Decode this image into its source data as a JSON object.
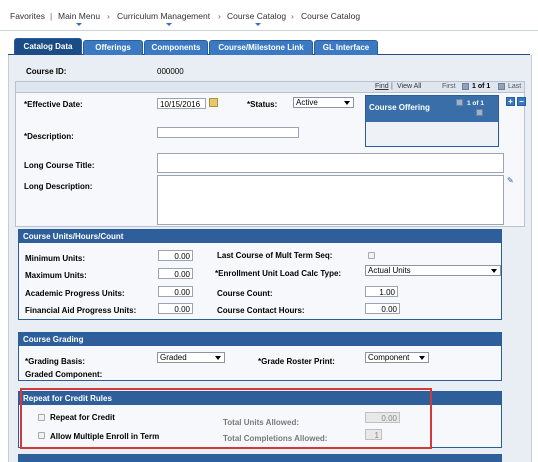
{
  "breadcrumb": {
    "items": [
      "Favorites",
      "Main Menu",
      "Curriculum Management",
      "Course Catalog",
      "Course Catalog"
    ],
    "separator": "›"
  },
  "tabs": [
    "Catalog Data",
    "Offerings",
    "Components",
    "Course/Milestone Link",
    "GL Interface"
  ],
  "header": {
    "course_id_label": "Course ID:",
    "course_id_value": "000000"
  },
  "nav": {
    "find": "Find",
    "view_all": "View All",
    "first": "First",
    "page_info": "1 of 1",
    "last": "Last"
  },
  "form": {
    "effective_date_label": "*Effective Date:",
    "effective_date_value": "10/15/2016",
    "status_label": "*Status:",
    "status_value": "Active",
    "description_label": "*Description:",
    "description_value": "",
    "long_title_label": "Long Course Title:",
    "long_desc_label": "Long Description:",
    "course_offering_label": "Course Offering",
    "course_offering_page": "1 of 1"
  },
  "units_section": {
    "title": "Course Units/Hours/Count",
    "min_units_label": "Minimum Units:",
    "min_units_value": "0.00",
    "max_units_label": "Maximum Units:",
    "max_units_value": "0.00",
    "acad_progress_label": "Academic Progress Units:",
    "acad_progress_value": "0.00",
    "fin_aid_label": "Financial Aid Progress Units:",
    "fin_aid_value": "0.00",
    "last_course_label": "Last Course of Mult Term Seq:",
    "enroll_calc_label": "*Enrollment Unit Load Calc Type:",
    "enroll_calc_value": "Actual Units",
    "course_count_label": "Course Count:",
    "course_count_value": "1.00",
    "contact_hours_label": "Course Contact Hours:",
    "contact_hours_value": "0.00"
  },
  "grading_section": {
    "title": "Course Grading",
    "grading_basis_label": "*Grading Basis:",
    "grading_basis_value": "Graded",
    "grade_roster_label": "*Grade Roster Print:",
    "grade_roster_value": "Component",
    "graded_component_label": "Graded Component:"
  },
  "repeat_section": {
    "title": "Repeat for Credit Rules",
    "repeat_label": "Repeat for Credit",
    "multi_enroll_label": "Allow Multiple Enroll in Term",
    "total_units_label": "Total Units Allowed:",
    "total_units_value": "0.00",
    "total_completions_label": "Total Completions Allowed:",
    "total_completions_value": "1"
  },
  "colors": {
    "tab_blue": "#3b7ac2",
    "section_header": "#2e5f9a",
    "highlight_red": "#d23a3a"
  },
  "icons": {
    "calendar": "calendar-icon",
    "spellcheck": "spellcheck-icon",
    "add": "add-row-icon",
    "delete": "delete-row-icon"
  }
}
